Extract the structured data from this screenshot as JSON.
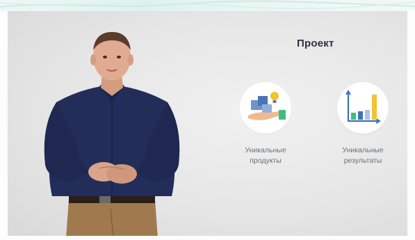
{
  "slide": {
    "title": "Проект",
    "items": [
      {
        "label_line1": "Уникальные",
        "label_line2": "продукты",
        "icon": "hand-boxes-lightbulb-icon"
      },
      {
        "label_line1": "Уникальные",
        "label_line2": "результаты",
        "icon": "bar-chart-icon"
      }
    ]
  },
  "colors": {
    "title": "#2b3340",
    "caption": "#6b6f75",
    "accent_green": "#3bbf7a",
    "accent_blue": "#3b74b8",
    "accent_yellow": "#f2c230",
    "shirt": "#232d5a",
    "pants": "#a07a4e"
  }
}
